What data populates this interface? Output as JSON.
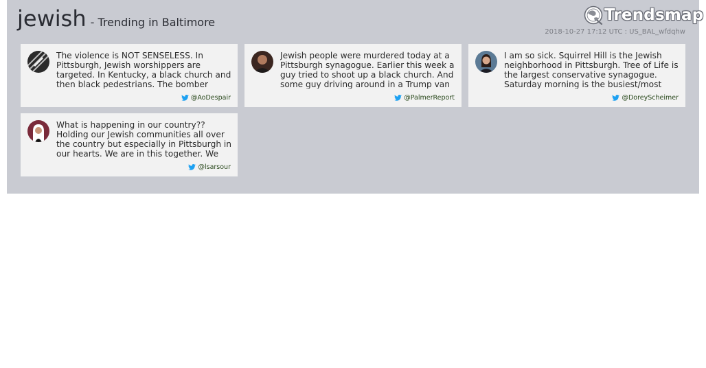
{
  "header": {
    "keyword": "jewish",
    "subtitle": "- Trending in Baltimore",
    "logo_text": "Trendsmap",
    "timestamp": "2018-10-27 17:12 UTC : US_BAL_wfdqhw"
  },
  "tweets": [
    {
      "text": "The violence is NOT SENSELESS. In Pittsburgh, Jewish worshippers are targeted. In Kentucky, a black church and then black pedestrians. The bomber targeted critics and prominent liberals.",
      "handle": "@AoDespair",
      "avatar": "avatar-aodespair"
    },
    {
      "text": "Jewish people were murdered today at a Pittsburgh synagogue. Earlier this week a guy tried to shoot up a black church. And some guy driving around in a Trump van mailed bombs to prominent critics.",
      "handle": "@PalmerReport",
      "avatar": "avatar-palmerreport"
    },
    {
      "text": "I am so sick. Squirrel Hill is the Jewish neighborhood in Pittsburgh. Tree of Life is the largest conservative synagogue. Saturday morning is the busiest/most crowded service.",
      "handle": "@DoreyScheimer",
      "avatar": "avatar-doreyscheimer"
    },
    {
      "text": "What is happening in our country?? Holding our Jewish communities all over the country but especially in Pittsburgh in our hearts. We are in this together. We have to stand together.",
      "handle": "@lsarsour",
      "avatar": "avatar-lsarsour"
    }
  ],
  "colors": {
    "panel": "#c9cbd2",
    "card": "#f2f2f2",
    "twitter_blue": "#1da1f2"
  }
}
